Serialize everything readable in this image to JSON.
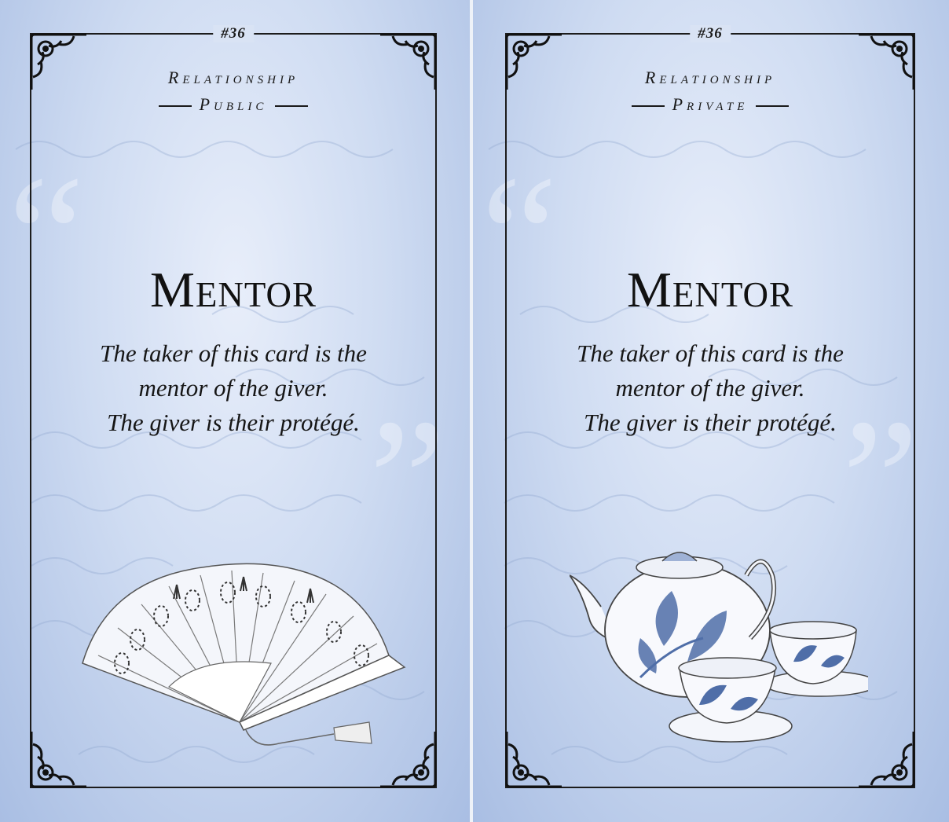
{
  "cards": [
    {
      "number": "#36",
      "category": "Relationship",
      "subcategory": "Public",
      "title": "Mentor",
      "lines": [
        "The taker of this card is the",
        "mentor of the giver.",
        "The giver is their protégé."
      ],
      "illustration": "fan-icon"
    },
    {
      "number": "#36",
      "category": "Relationship",
      "subcategory": "Private",
      "title": "Mentor",
      "lines": [
        "The taker of this card is the",
        "mentor of the giver.",
        "The giver is their protégé."
      ],
      "illustration": "teapot-icon"
    }
  ],
  "colors": {
    "card_light": "#e8eefa",
    "card_dark": "#a9bee3",
    "ink": "#1a1a1a",
    "porcelain_blue": "#4f6ea8"
  }
}
